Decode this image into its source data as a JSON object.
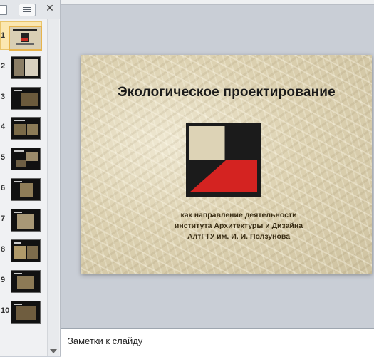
{
  "thumbnail_pane": {
    "close_glyph": "✕",
    "slides": [
      {
        "number": "1"
      },
      {
        "number": "2"
      },
      {
        "number": "3"
      },
      {
        "number": "4"
      },
      {
        "number": "5"
      },
      {
        "number": "6"
      },
      {
        "number": "7"
      },
      {
        "number": "8"
      },
      {
        "number": "9"
      },
      {
        "number": "10"
      }
    ]
  },
  "slide": {
    "title": "Экологическое проектирование",
    "subtitle_lines": [
      "как направление деятельности",
      "института Архитектуры и Дизайна",
      "АлтГТУ им. И. И. Ползунова"
    ],
    "logo": {
      "dark_color": "#1b1b1b",
      "red_color": "#d42321"
    }
  },
  "notes": {
    "placeholder": "Заметки к слайду"
  },
  "colors": {
    "selection": "#e7b34b",
    "pane_bg": "#f0f1f3",
    "workspace_bg": "#c9ced6"
  }
}
